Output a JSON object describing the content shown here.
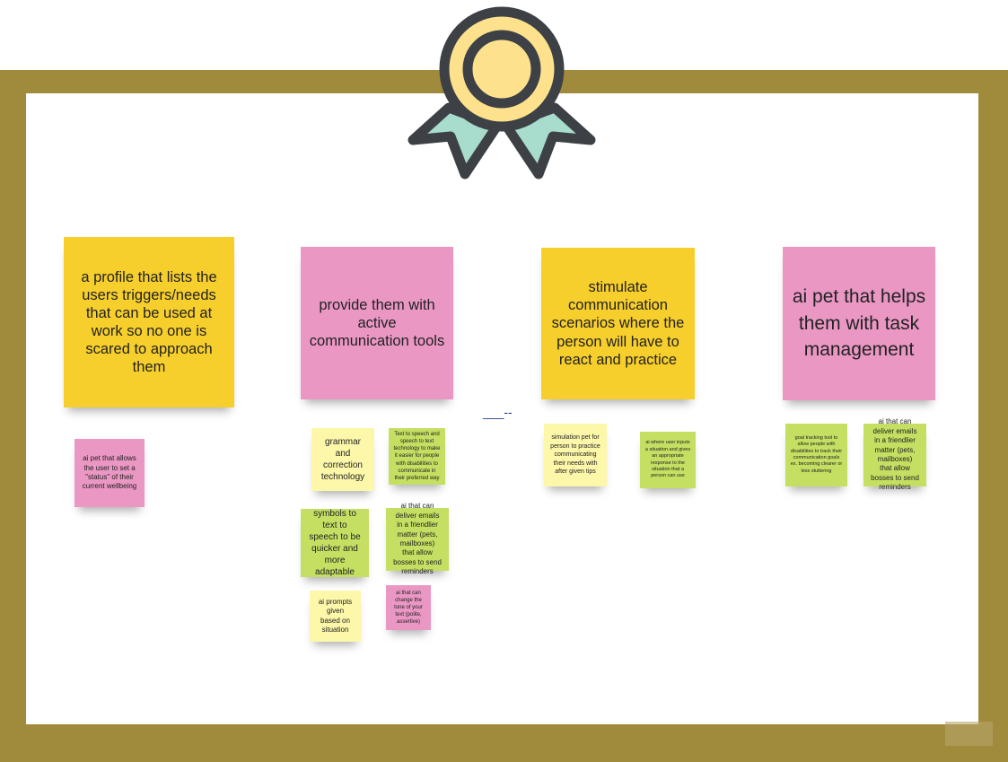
{
  "board": {
    "marker_text": "___--",
    "columns": [
      {
        "header": "a profile that lists the users triggers/needs that can be used at work so no one is scared to approach them",
        "notes": [
          "ai pet that allows the user to set a \"status\" of their current wellbeing"
        ]
      },
      {
        "header": "provide them with active communication tools",
        "notes": [
          "grammar and correction technology",
          "Text to speech and speech to text technology to make it easier for people with disabilities to communicate in their preferred way",
          "symbols to text to speech to be quicker and more adaptable",
          "ai that can deliver emails in a friendlier matter (pets, mailboxes) that allow bosses to send reminders",
          "ai prompts given based on situation",
          "ai that can change the tone of your text (polite, assertive)"
        ]
      },
      {
        "header": "stimulate communication scenarios where the person will have to react and practice",
        "notes": [
          "simulation pet for person to practice communicating their needs with after given tips",
          "ai where user inputs a situation and gives an appropriate response to the situation that a person can use"
        ]
      },
      {
        "header": "ai pet that helps them with task management",
        "notes": [
          "goal tracking tool to allow people with disabilities to track their communication goals ex. becoming clearer or less stuttering",
          "ai that can deliver emails in a friendlier matter (pets, mailboxes) that allow bosses to send reminders"
        ]
      }
    ]
  },
  "colors": {
    "frame": "#a08a3b",
    "yellow": "#f7cf2c",
    "pink": "#ea97c4",
    "light_yellow": "#fdf7a9",
    "light_green": "#c5df62",
    "badge_center": "#fde18d",
    "badge_ribbon": "#a8dccd",
    "badge_outline": "#3d4145"
  },
  "icons": {
    "badge": "award-ribbon-icon"
  }
}
